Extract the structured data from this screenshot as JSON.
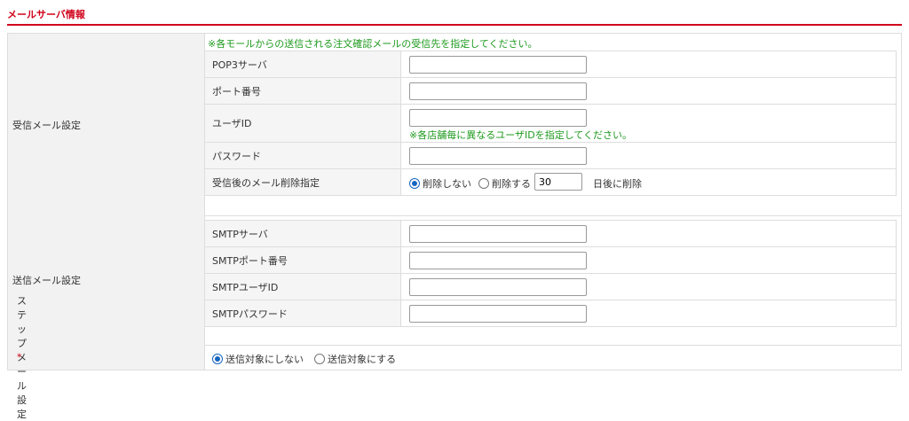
{
  "section_title": "メールサーバ情報",
  "receive": {
    "label": "受信メール設定",
    "note": "※各モールからの送信される注文確認メールの受信先を指定してください。",
    "fields": {
      "pop3": {
        "label": "POP3サーバ",
        "value": ""
      },
      "port": {
        "label": "ポート番号",
        "value": ""
      },
      "user": {
        "label": "ユーザID",
        "value": "",
        "note": "※各店舗毎に異なるユーザIDを指定してください。"
      },
      "password": {
        "label": "パスワード",
        "value": ""
      },
      "delete": {
        "label": "受信後のメール削除指定",
        "option_no": "削除しない",
        "option_yes": "削除する",
        "selected": "削除しない",
        "days": "30",
        "days_suffix": "日後に削除"
      }
    }
  },
  "send": {
    "label": "送信メール設定",
    "fields": {
      "smtp_server": {
        "label": "SMTPサーバ",
        "value": ""
      },
      "smtp_port": {
        "label": "SMTPポート番号",
        "value": ""
      },
      "smtp_user": {
        "label": "SMTPユーザID",
        "value": ""
      },
      "smtp_password": {
        "label": "SMTPパスワード",
        "value": ""
      }
    }
  },
  "step_mail": {
    "label": "ステップメール設定",
    "required_mark": "*",
    "option_no": "送信対象にしない",
    "option_yes": "送信対象にする",
    "selected": "送信対象にしない"
  },
  "colors": {
    "accent": "#d0021b",
    "note": "#1e9a1e",
    "radio_selected": "#1565c0"
  }
}
